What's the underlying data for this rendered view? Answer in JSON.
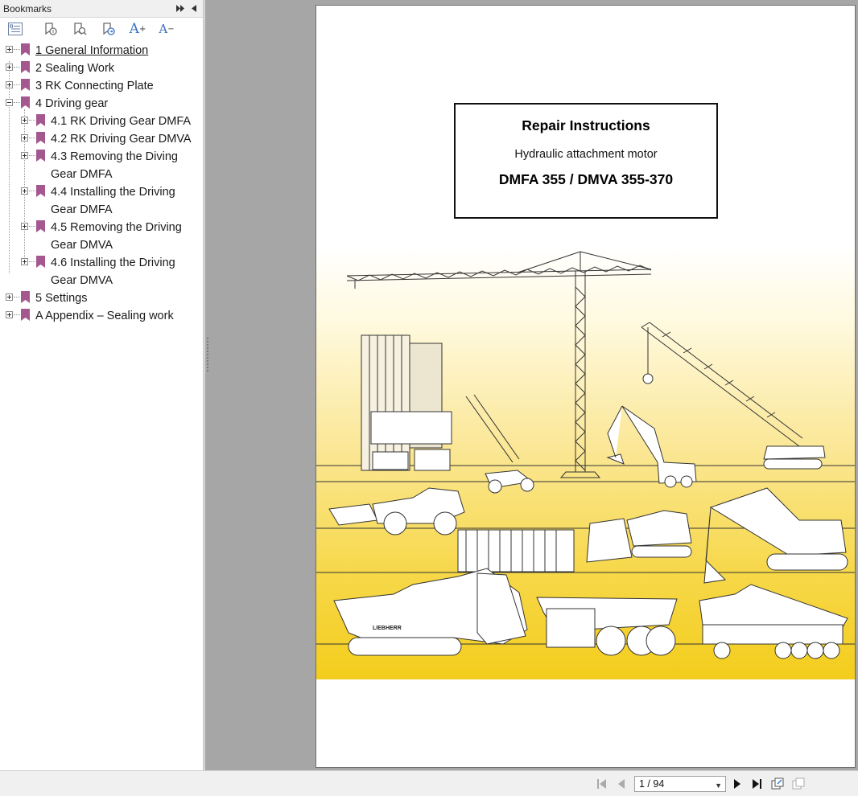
{
  "sidebar": {
    "title": "Bookmarks",
    "toolbar": {
      "buttons": [
        "expand-all",
        "bookmark-1",
        "bookmark-2",
        "bookmark-3",
        "font-larger",
        "font-smaller"
      ],
      "font_larger_label": "A",
      "font_larger_sup": "+",
      "font_smaller_label": "A",
      "font_smaller_sup": "−"
    },
    "bookmarks": [
      {
        "label": "1 General Information",
        "level": 0,
        "expander": "plus",
        "selected": true
      },
      {
        "label": "2 Sealing Work",
        "level": 0,
        "expander": "plus"
      },
      {
        "label": "3 RK Connecting Plate",
        "level": 0,
        "expander": "plus"
      },
      {
        "label": "4 Driving gear",
        "level": 0,
        "expander": "minus"
      },
      {
        "label": "4.1 RK Driving Gear DMFA",
        "level": 1,
        "expander": "plus"
      },
      {
        "label": "4.2 RK Driving Gear DMVA",
        "level": 1,
        "expander": "plus"
      },
      {
        "label": "4.3 Removing the Diving Gear DMFA",
        "level": 1,
        "expander": "plus"
      },
      {
        "label": "4.4 Installing the Driving Gear DMFA",
        "level": 1,
        "expander": "plus"
      },
      {
        "label": "4.5 Removing the Driving Gear DMVA",
        "level": 1,
        "expander": "plus"
      },
      {
        "label": "4.6 Installing the Driving Gear DMVA",
        "level": 1,
        "expander": "plus"
      },
      {
        "label": "5 Settings",
        "level": 0,
        "expander": "plus"
      },
      {
        "label": "A Appendix – Sealing work",
        "level": 0,
        "expander": "plus"
      }
    ],
    "bookmark_icon_color": "#a4588f"
  },
  "document": {
    "title": "Repair Instructions",
    "subtitle": "Hydraulic attachment motor",
    "model": "DMFA 355 / DMVA 355-370",
    "artwork_brand_text": "LIEBHERR",
    "accent_yellow": "#f3cd1c"
  },
  "statusbar": {
    "page_indicator": "1 / 94",
    "buttons": [
      "first-page",
      "previous-page",
      "next-page",
      "last-page",
      "window-1",
      "window-2"
    ]
  }
}
